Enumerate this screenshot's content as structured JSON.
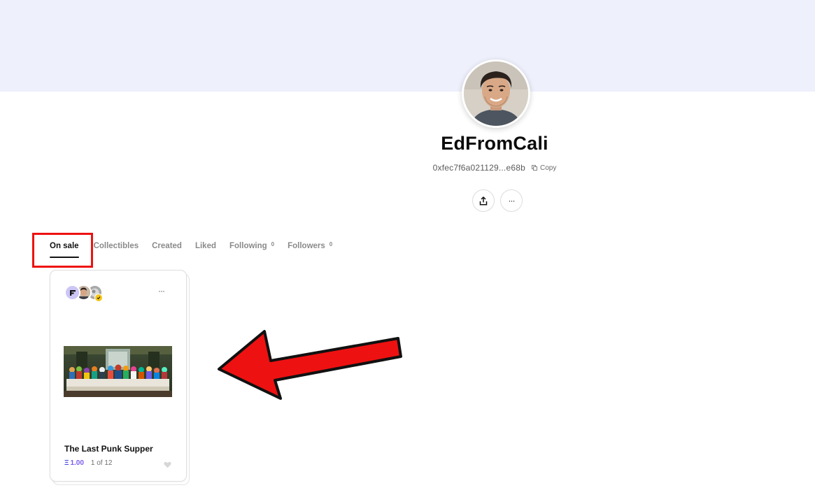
{
  "profile": {
    "username": "EdFromCali",
    "address": "0xfec7f6a021129...e68b",
    "copy_label": "Copy"
  },
  "actions": {
    "share_icon": "share-icon",
    "more_label": "···"
  },
  "tabs": [
    {
      "label": "On sale",
      "active": true
    },
    {
      "label": "Collectibles"
    },
    {
      "label": "Created"
    },
    {
      "label": "Liked"
    },
    {
      "label": "Following",
      "count": "0"
    },
    {
      "label": "Followers",
      "count": "0"
    }
  ],
  "card": {
    "title": "The Last Punk Supper",
    "price_symbol": "Ξ",
    "price": "1.00",
    "edition": "1 of 12",
    "more_label": "···",
    "like_icon": "heart-icon"
  },
  "annotations": {
    "highlight_color": "#ee1111",
    "arrow_color": "#ee1111",
    "cover_color": "#eef0fc",
    "accent_color": "#5b5ff2"
  }
}
